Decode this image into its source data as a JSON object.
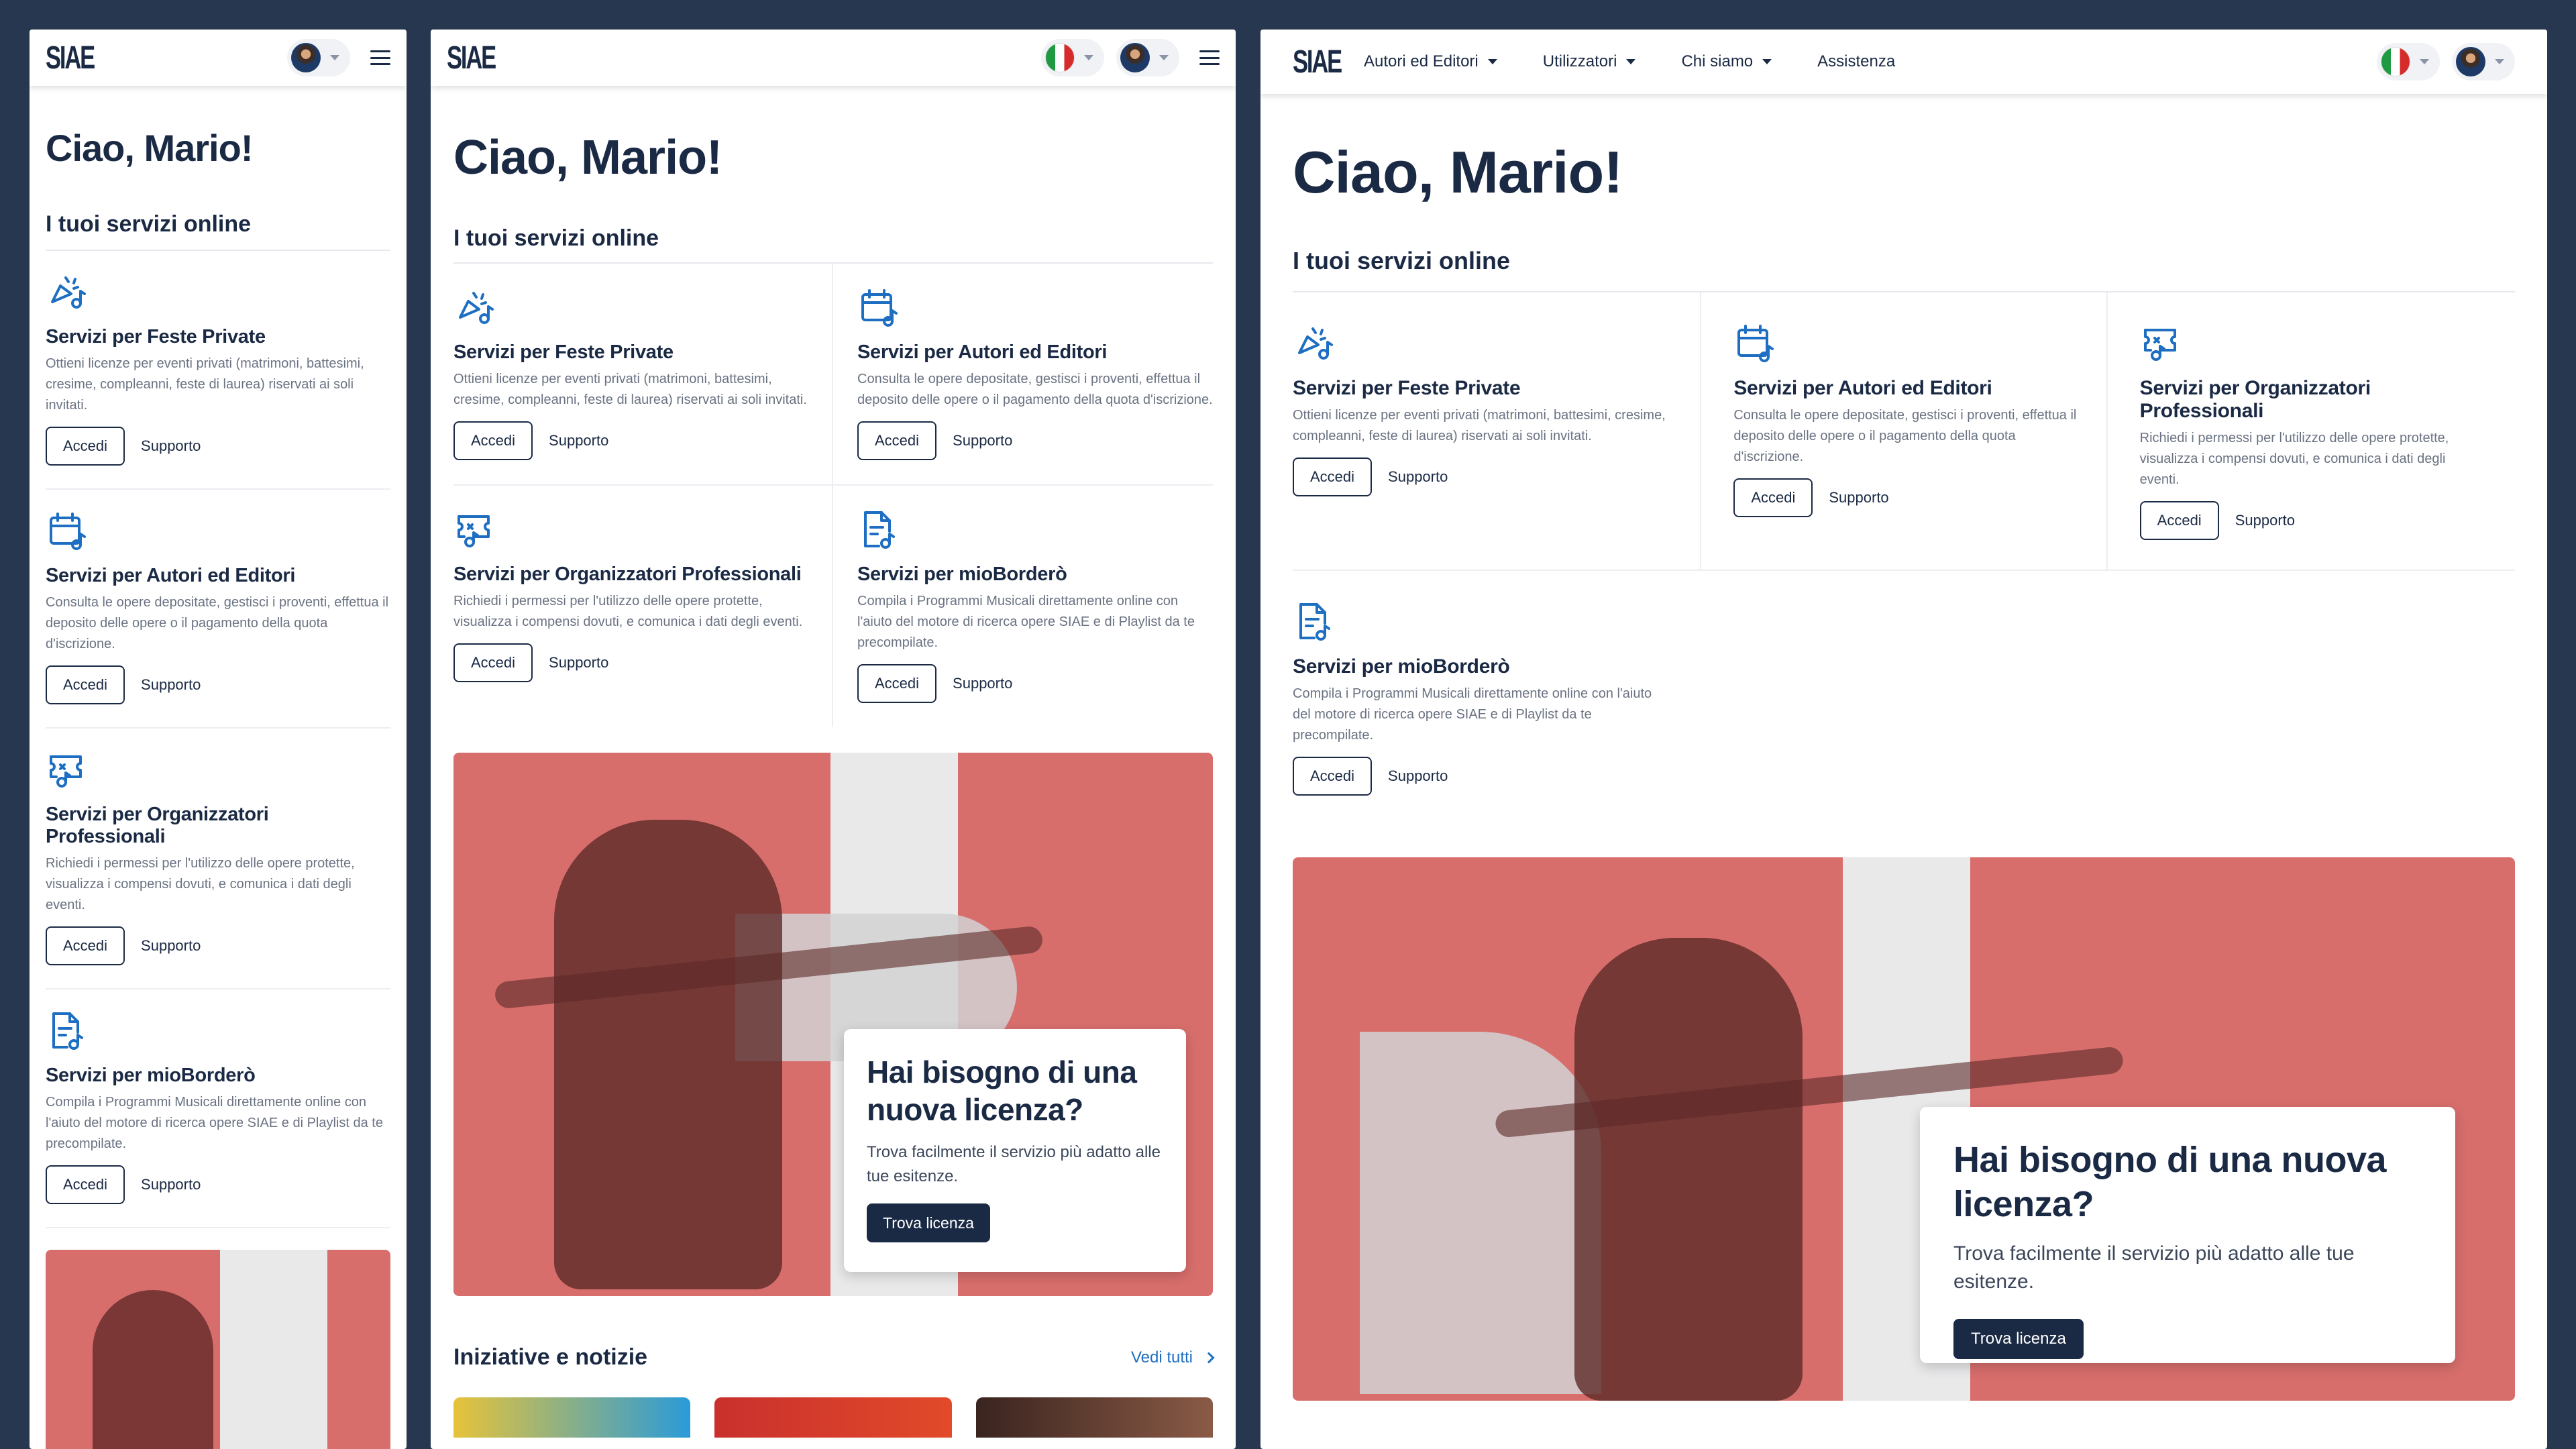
{
  "brand": "SIAE",
  "nav": {
    "links": [
      "Autori ed Editori",
      "Utilizzatori",
      "Chi siamo",
      "Assistenza"
    ]
  },
  "greeting": "Ciao, Mario!",
  "services_title": "I tuoi servizi online",
  "services": [
    {
      "name": "Servizi per Feste Private",
      "icon": "party-music-icon",
      "desc": "Ottieni licenze per eventi privati (matrimoni, battesimi, cresime, compleanni, feste di laurea) riservati ai soli invitati."
    },
    {
      "name": "Servizi per Autori ed Editori",
      "icon": "calendar-music-icon",
      "desc": "Consulta le opere depositate, gestisci i proventi, effettua il deposito delle opere o il pagamento della quota d'iscrizione."
    },
    {
      "name": "Servizi per Organizzatori Professionali",
      "icon": "ticket-music-icon",
      "desc": "Richiedi i permessi per l'utilizzo delle opere protette, visualizza i compensi dovuti, e comunica i dati degli eventi."
    },
    {
      "name": "Servizi per mioBorderò",
      "icon": "document-music-icon",
      "desc": "Compila i Programmi Musicali direttamente online con l'aiuto del motore di ricerca opere SIAE e di Playlist da te precompilate."
    }
  ],
  "labels": {
    "access": "Accedi",
    "support": "Supporto"
  },
  "hero": {
    "title": "Hai bisogno di una nuova licenza?",
    "text": "Trova facilmente il servizio più adatto alle tue esitenze.",
    "button": "Trova licenza"
  },
  "news": {
    "title": "Iniziative e notizie",
    "see_all": "Vedi tutti"
  },
  "colors": {
    "brand_dark": "#1b2a44",
    "accent_blue": "#1e6fc2",
    "hero_red": "#d76e6c",
    "background": "#283750"
  }
}
